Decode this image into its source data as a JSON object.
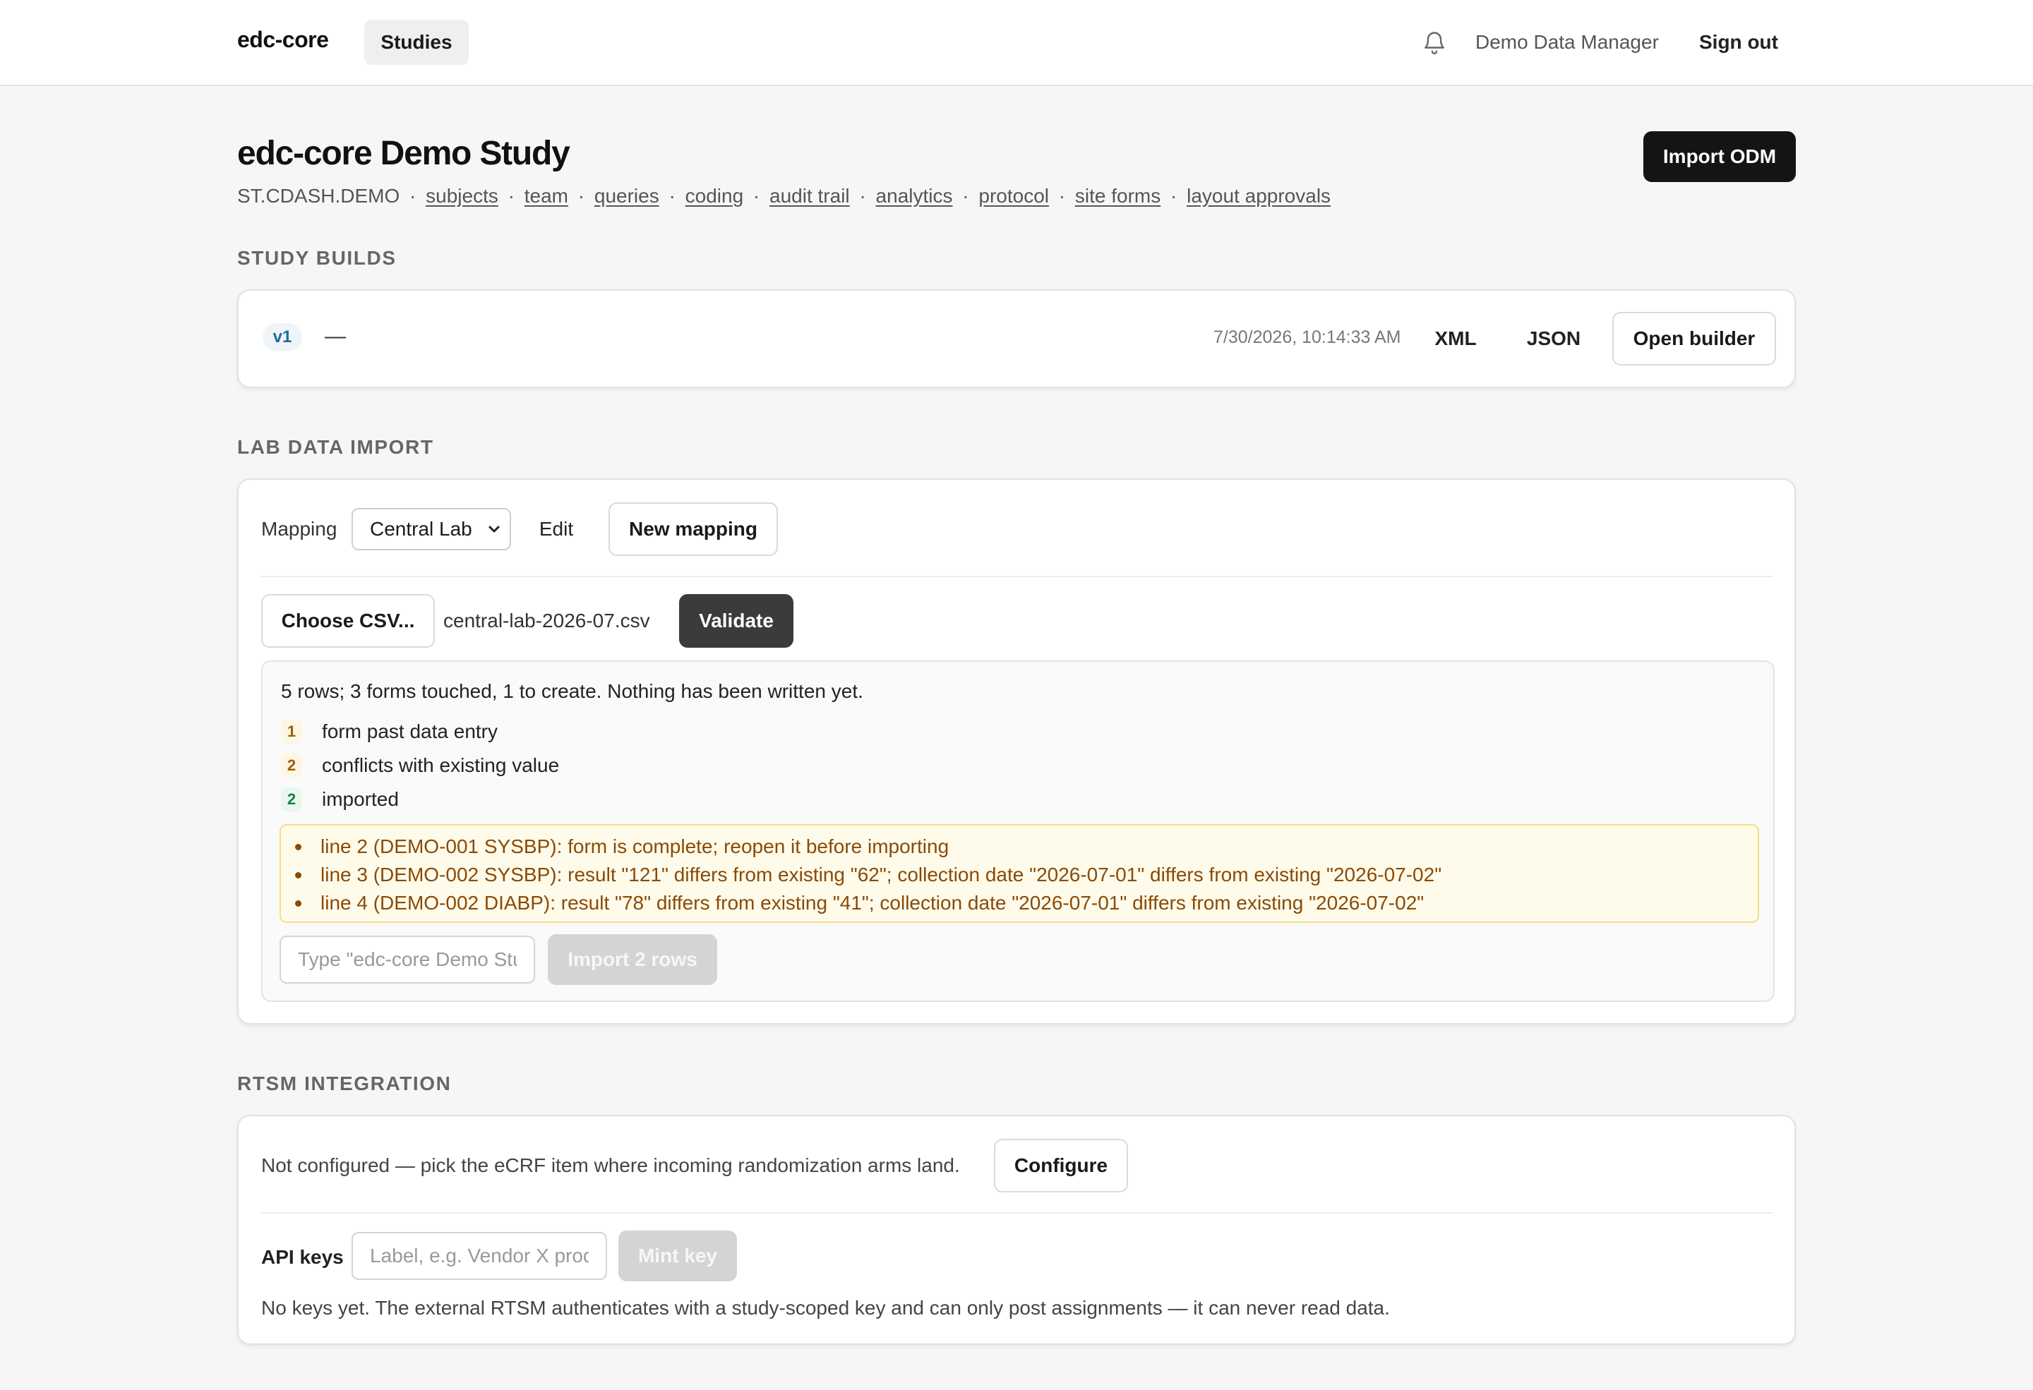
{
  "topbar": {
    "brand": "edc-core",
    "nav_studies": "Studies",
    "bell_icon": "bell-icon",
    "user_name": "Demo Data Manager",
    "sign_out": "Sign out"
  },
  "header": {
    "title": "edc-core Demo Study",
    "study_code": "ST.CDASH.DEMO",
    "separator": "·",
    "links": [
      "subjects",
      "team",
      "queries",
      "coding",
      "audit trail",
      "analytics",
      "protocol",
      "site forms",
      "layout approvals"
    ],
    "import_odm": "Import ODM"
  },
  "builds": {
    "section_title": "STUDY BUILDS",
    "version": "v1",
    "name": "—",
    "timestamp": "7/30/2026, 10:14:33 AM",
    "xml": "XML",
    "json": "JSON",
    "open_builder": "Open builder"
  },
  "lab_import": {
    "section_title": "LAB DATA IMPORT",
    "mapping_label": "Mapping",
    "mapping_value": "Central Lab",
    "edit": "Edit",
    "new_mapping": "New mapping",
    "choose_csv": "Choose CSV...",
    "filename": "central-lab-2026-07.csv",
    "validate": "Validate",
    "summary": "5 rows; 3 forms touched, 1 to create. Nothing has been written yet.",
    "stats": [
      {
        "count": "1",
        "label": "form past data entry",
        "tone": "amber"
      },
      {
        "count": "2",
        "label": "conflicts with existing value",
        "tone": "amber"
      },
      {
        "count": "2",
        "label": "imported",
        "tone": "green"
      }
    ],
    "warnings": [
      "line 2 (DEMO-001 SYSBP): form is complete; reopen it before importing",
      "line 3 (DEMO-002 SYSBP): result \"121\" differs from existing \"62\"; collection date \"2026-07-01\" differs from existing \"2026-07-02\"",
      "line 4 (DEMO-002 DIABP): result \"78\" differs from existing \"41\"; collection date \"2026-07-01\" differs from existing \"2026-07-02\""
    ],
    "confirm_placeholder": "Type \"edc-core Demo Study\" to confirm",
    "confirm_value": "",
    "import_button": "Import 2 rows"
  },
  "rtsm": {
    "section_title": "RTSM INTEGRATION",
    "status_text": "Not configured — pick the eCRF item where incoming randomization arms land.",
    "configure": "Configure",
    "api_keys_label": "API keys",
    "key_placeholder": "Label, e.g. Vendor X production",
    "key_value": "",
    "mint_key": "Mint key",
    "empty_note": "No keys yet. The external RTSM authenticates with a study-scoped key and can only post assignments — it can never read data."
  },
  "colors": {
    "primary_button": "#141414",
    "warning_bg": "#fffbea",
    "warning_text": "#8a4a06",
    "success_text": "#17804a",
    "version_badge": "#1e6f99"
  }
}
